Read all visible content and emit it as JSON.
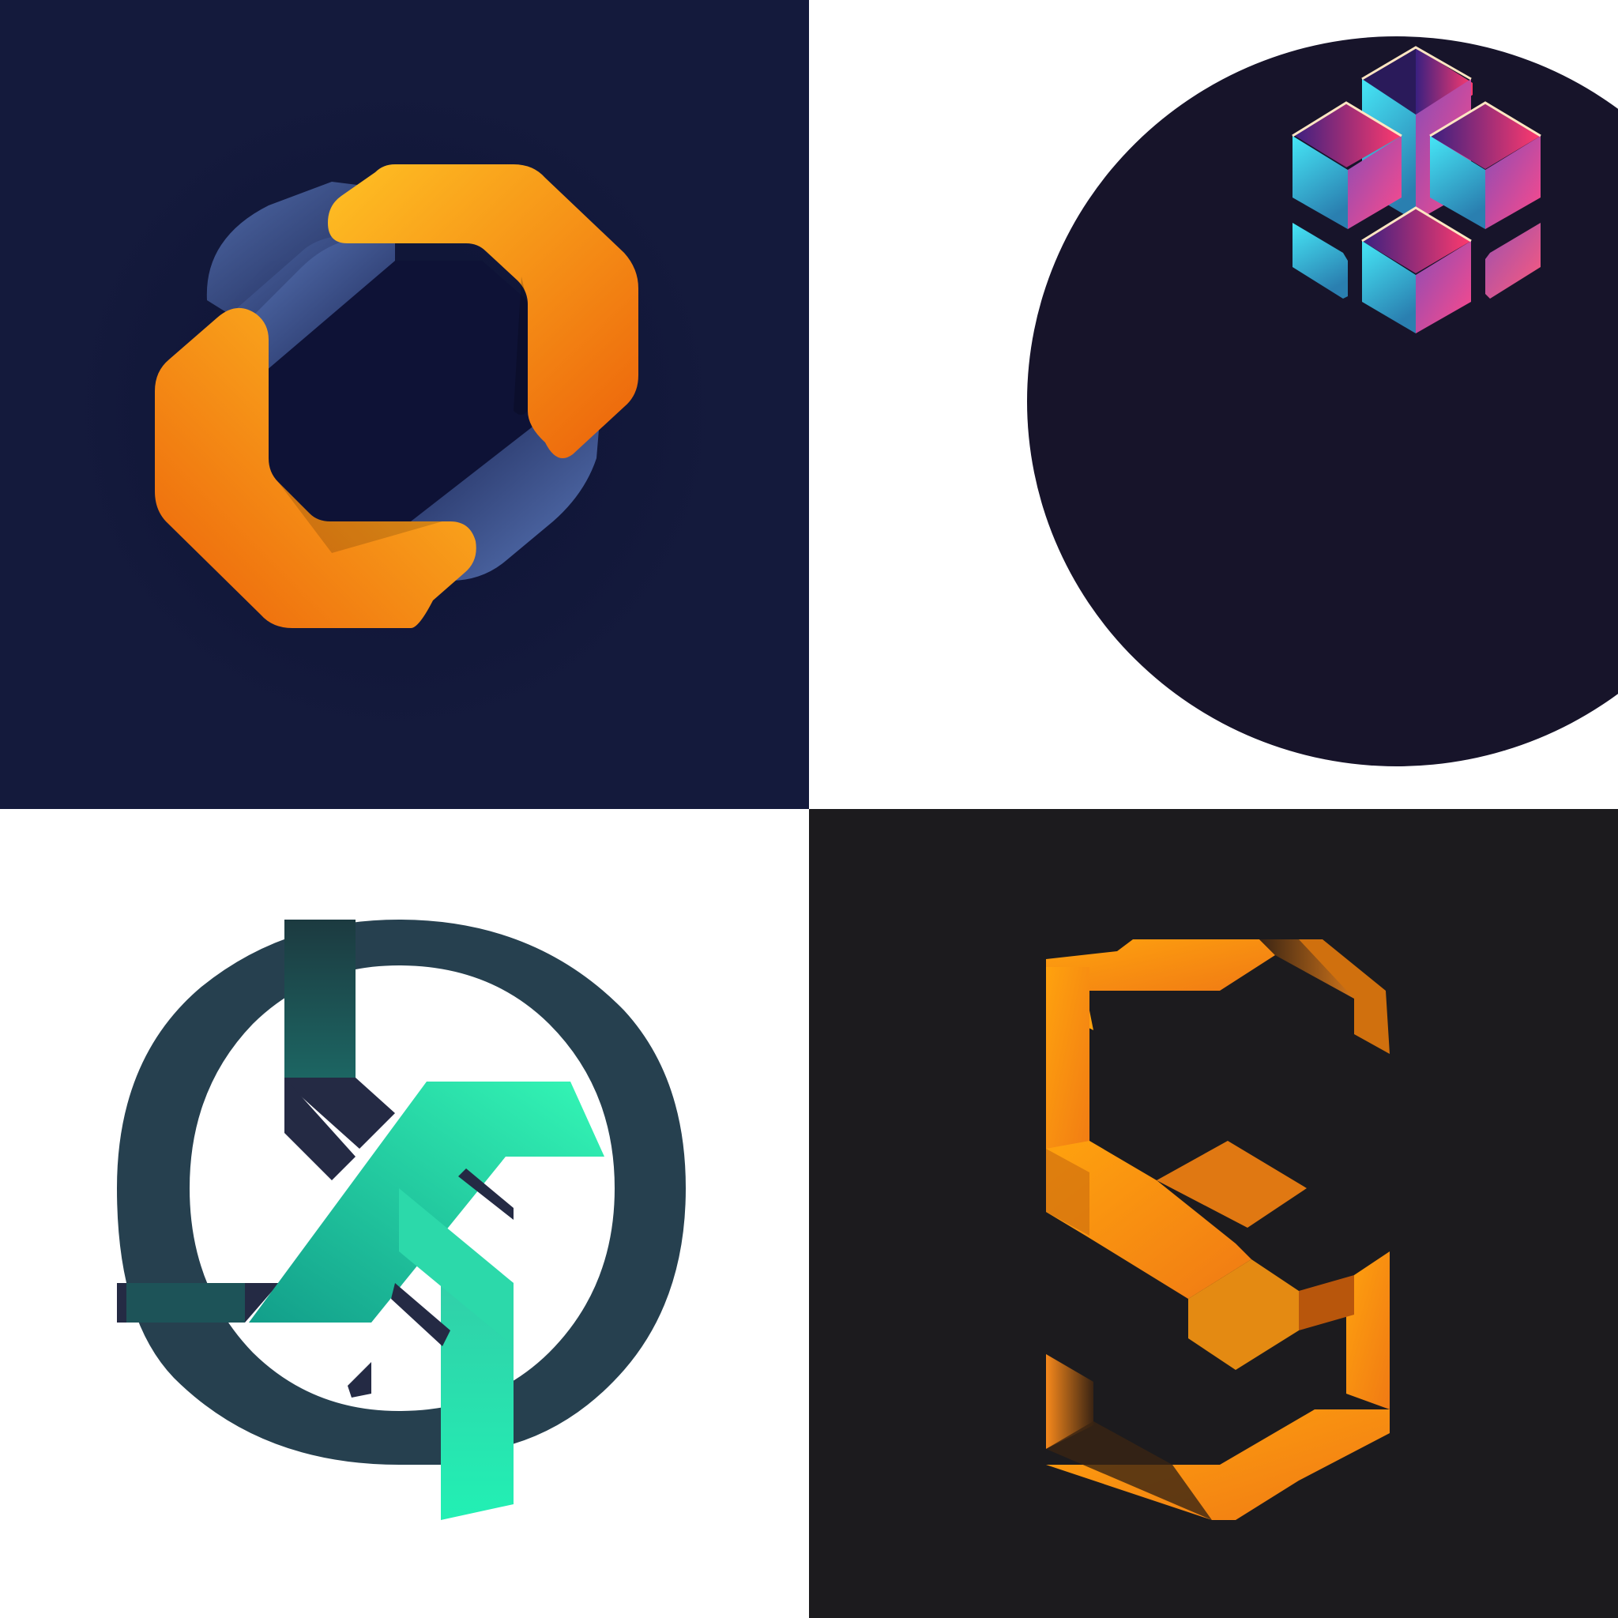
{
  "tiles": [
    {
      "id": "tile-1",
      "logo": "orange-octagon-ring-logo",
      "background": "#141a3c",
      "colors": {
        "primary_light": "#ffc124",
        "primary_dark": "#ec620a",
        "secondary_light": "#5a78ba",
        "secondary_dark": "#1c2654",
        "inner": "#0e1236"
      }
    },
    {
      "id": "tile-2",
      "logo": "isometric-cubes-circle-logo",
      "background": "#ffffff",
      "colors": {
        "circle": "#17142a",
        "cyan": "#3fe0f2",
        "blue": "#2c6ea6",
        "magenta": "#a23d9e",
        "pink": "#ff4f86",
        "purple": "#5a2aa6",
        "top_dark": "#1a1430",
        "edge": "#ffe6c2"
      }
    },
    {
      "id": "tile-3",
      "logo": "teal-ring-emblem-logo",
      "background": "#ffffff",
      "colors": {
        "ring": "#26404f",
        "navy": "#242a44",
        "green_light": "#34f7b6",
        "green_mid": "#16bf96",
        "green_dark": "#1c5e5e"
      }
    },
    {
      "id": "tile-4",
      "logo": "orange-hexagon-s-logo",
      "background": "#1c1b1e",
      "colors": {
        "orange_light": "#ffa20e",
        "orange": "#f7891c",
        "orange_dark": "#b8560c",
        "shadow": "#3a2413"
      }
    }
  ]
}
